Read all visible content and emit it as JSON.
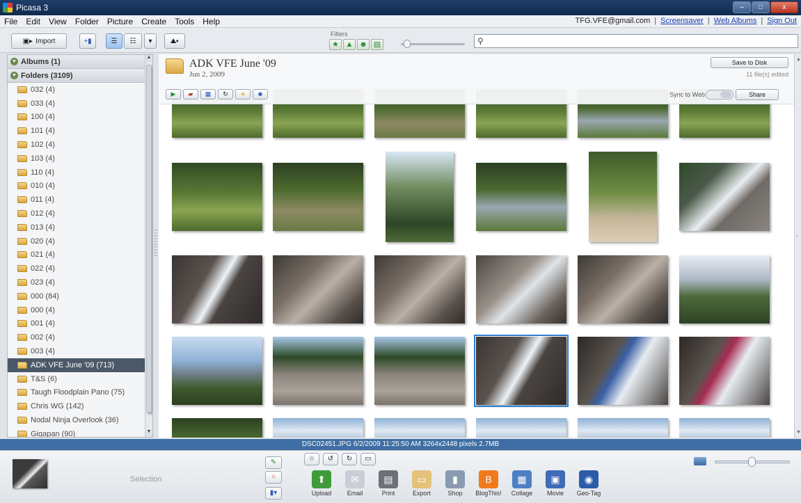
{
  "window": {
    "title": "Picasa 3",
    "buttons": [
      "–",
      "□",
      "x"
    ]
  },
  "menu": [
    "File",
    "Edit",
    "View",
    "Folder",
    "Picture",
    "Create",
    "Tools",
    "Help"
  ],
  "account": {
    "email": "TFG.VFE@gmail.com",
    "links": [
      "Screensaver",
      "Web Albums",
      "Sign Out"
    ]
  },
  "toolbar": {
    "import_label": "Import",
    "filters_label": "Filters",
    "filter_icons": [
      "star-icon",
      "upload-icon",
      "person-icon",
      "movie-icon"
    ]
  },
  "left_panel": {
    "albums_header": "Albums (1)",
    "folders_header": "Folders (3109)",
    "folders": [
      {
        "label": "032 (4)",
        "selected": false
      },
      {
        "label": "033 (4)",
        "selected": false
      },
      {
        "label": "100 (4)",
        "selected": false
      },
      {
        "label": "101 (4)",
        "selected": false
      },
      {
        "label": "102 (4)",
        "selected": false
      },
      {
        "label": "103 (4)",
        "selected": false
      },
      {
        "label": "110 (4)",
        "selected": false
      },
      {
        "label": "010 (4)",
        "selected": false
      },
      {
        "label": "011 (4)",
        "selected": false
      },
      {
        "label": "012 (4)",
        "selected": false
      },
      {
        "label": "013 (4)",
        "selected": false
      },
      {
        "label": "020 (4)",
        "selected": false
      },
      {
        "label": "021 (4)",
        "selected": false
      },
      {
        "label": "022 (4)",
        "selected": false
      },
      {
        "label": "023 (4)",
        "selected": false
      },
      {
        "label": "000 (84)",
        "selected": false
      },
      {
        "label": "000 (4)",
        "selected": false
      },
      {
        "label": "001 (4)",
        "selected": false
      },
      {
        "label": "002 (4)",
        "selected": false
      },
      {
        "label": "003 (4)",
        "selected": false
      },
      {
        "label": "ADK VFE June '09 (713)",
        "selected": true
      },
      {
        "label": "T&S (6)",
        "selected": false
      },
      {
        "label": "Taugh Floodplain Pano (75)",
        "selected": false
      },
      {
        "label": "Chris WG (142)",
        "selected": false
      },
      {
        "label": "Nodal Ninja Overlook (36)",
        "selected": false
      },
      {
        "label": "Gigapan (90)",
        "selected": false
      }
    ]
  },
  "album": {
    "title": "ADK VFE June '09",
    "date": "Jun 2, 2009",
    "save_label": "Save to Disk",
    "edited_label": "11 file(s) edited",
    "sync_label": "Sync to Web",
    "share_label": "Share"
  },
  "thumbnails": [
    {
      "scene": "forest"
    },
    {
      "scene": "forest"
    },
    {
      "scene": "trail"
    },
    {
      "scene": "forest"
    },
    {
      "scene": "stream"
    },
    {
      "scene": "forest"
    },
    {
      "scene": "forest"
    },
    {
      "scene": "trail"
    },
    {
      "scene": "sky-tree"
    },
    {
      "scene": "stream"
    },
    {
      "scene": "forest-sand"
    },
    {
      "scene": "waterfall-rock"
    },
    {
      "scene": "waterfall"
    },
    {
      "scene": "rock"
    },
    {
      "scene": "rock"
    },
    {
      "scene": "rock-water"
    },
    {
      "scene": "rock"
    },
    {
      "scene": "mountain"
    },
    {
      "scene": "mountain-sky"
    },
    {
      "scene": "slab-sky"
    },
    {
      "scene": "slab-sky"
    },
    {
      "scene": "waterfall",
      "selected": true
    },
    {
      "scene": "person-fall"
    },
    {
      "scene": "person-fall-red"
    },
    {
      "scene": "partial-forest"
    },
    {
      "scene": "partial-sky"
    },
    {
      "scene": "partial-sky"
    },
    {
      "scene": "partial-sky"
    },
    {
      "scene": "partial-sky"
    },
    {
      "scene": "partial-sky"
    }
  ],
  "status_bar": {
    "text": "DSC02451.JPG   6/2/2009 11:25:50 AM   3264x2448 pixels   2.7MB"
  },
  "bottom": {
    "selection_label": "Selection",
    "actions": [
      {
        "label": "Upload",
        "icon": "upload-icon",
        "color": "#3f9b3a"
      },
      {
        "label": "Email",
        "icon": "email-icon",
        "color": "#c9ced6"
      },
      {
        "label": "Print",
        "icon": "print-icon",
        "color": "#6b7079"
      },
      {
        "label": "Export",
        "icon": "export-folder-icon",
        "color": "#e3c27a"
      },
      {
        "label": "Shop",
        "icon": "shop-icon",
        "color": "#8a9bb0"
      },
      {
        "label": "BlogThis!",
        "icon": "blogger-icon",
        "color": "#f07a1c"
      },
      {
        "label": "Collage",
        "icon": "collage-icon",
        "color": "#4d7fc4"
      },
      {
        "label": "Movie",
        "icon": "movie-icon",
        "color": "#3f6bb7"
      },
      {
        "label": "Geo-Tag",
        "icon": "globe-icon",
        "color": "#2c5ca8"
      }
    ]
  }
}
